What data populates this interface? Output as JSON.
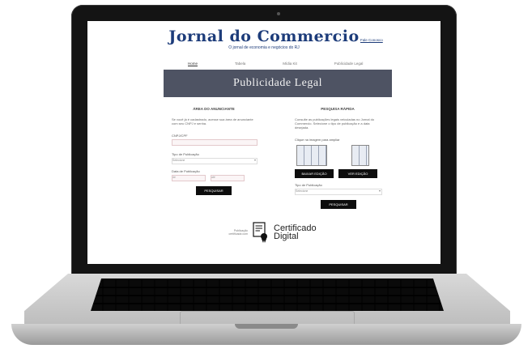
{
  "header": {
    "logo_title": "Jornal do Commercio",
    "logo_subtitle": "O jornal de economia e negócios do RJ",
    "top_link": "Fale Conosco"
  },
  "nav": {
    "items": [
      "Home",
      "Tabela",
      "Mídia Kit",
      "Publicidade Legal"
    ]
  },
  "banner": {
    "title": "Publicidade Legal"
  },
  "left_panel": {
    "heading": "ÁREA DO ANUNCIANTE",
    "intro": "Se você já é cadastrado, acesse sua área de anunciante com seu CNPJ e senha.",
    "cnpj_label": "CNPJ/CPF",
    "cnpj_placeholder": "",
    "password_label": "Tipo de Publicação",
    "select_placeholder": "Selecione",
    "date_label": "Data de Publicação",
    "from_placeholder": "de",
    "to_placeholder": "até",
    "submit_label": "PESQUISAR"
  },
  "right_panel": {
    "heading": "PESQUISA RÁPIDA",
    "intro": "Consulte as publicações legais veiculadas no Jornal do Commercio. Selecione o tipo de publicação e a data desejada.",
    "hint": "Clique na imagem para ampliar",
    "btn_a": "BAIXAR EDIÇÃO",
    "btn_b": "VER EDIÇÃO",
    "type_label": "Tipo de Publicação",
    "select_placeholder": "Selecione",
    "submit_label": "PESQUISAR"
  },
  "footer": {
    "small_text": "Publicação certificada com",
    "cert_line1": "Certificado",
    "cert_line2": "Digital"
  }
}
